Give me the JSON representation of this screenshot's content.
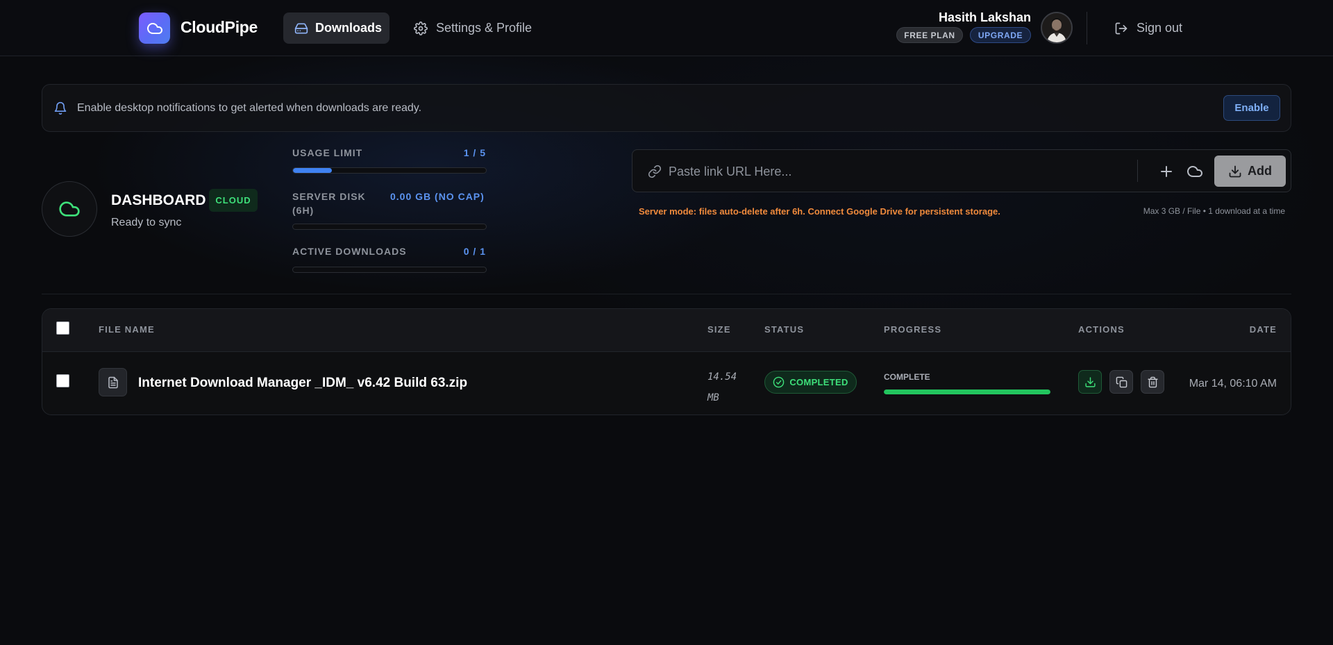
{
  "brand": {
    "name": "CloudPipe",
    "icon": "cloud-icon",
    "accent": "#6366f1"
  },
  "nav": {
    "downloads_label": "Downloads",
    "downloads_icon": "hard-drive-icon",
    "settings_label": "Settings & Profile",
    "settings_icon": "gear-icon"
  },
  "user": {
    "name": "Hasith Lakshan",
    "plan_badge": "FREE PLAN",
    "upgrade_badge": "UPGRADE",
    "signout_label": "Sign out"
  },
  "banner": {
    "message": "Enable desktop notifications to get alerted when downloads are ready.",
    "enable_label": "Enable"
  },
  "dashboard": {
    "title": "DASHBOARD",
    "mode_badge": "CLOUD",
    "subtitle": "Ready to sync",
    "stats": [
      {
        "label": "USAGE LIMIT",
        "value": "1 / 5",
        "fraction": 0.2
      },
      {
        "label": "SERVER DISK (6H)",
        "value": "0.00 GB (NO CAP)",
        "fraction": 0
      },
      {
        "label": "ACTIVE DOWNLOADS",
        "value": "0 / 1",
        "fraction": 0
      }
    ]
  },
  "url_input": {
    "placeholder": "Paste link URL Here...",
    "value": "",
    "add_label": "Add",
    "server_note": "Server mode: files auto-delete after 6h. Connect Google Drive for persistent storage.",
    "limit_note": "Max 3 GB / File • 1 download at a time"
  },
  "table": {
    "columns": [
      "FILE NAME",
      "SIZE",
      "STATUS",
      "PROGRESS",
      "ACTIONS",
      "DATE"
    ],
    "rows": [
      {
        "file_name": "Internet Download Manager _IDM_ v6.42 Build 63.zip",
        "size_num": "14.54",
        "size_unit": "MB",
        "status": "COMPLETED",
        "progress_label": "COMPLETE",
        "progress": 1.0,
        "date": "Mar 14, 06:10 AM"
      }
    ]
  },
  "colors": {
    "success": "#22c55e",
    "link_blue": "#5b93f0",
    "warning": "#f08a3c"
  }
}
